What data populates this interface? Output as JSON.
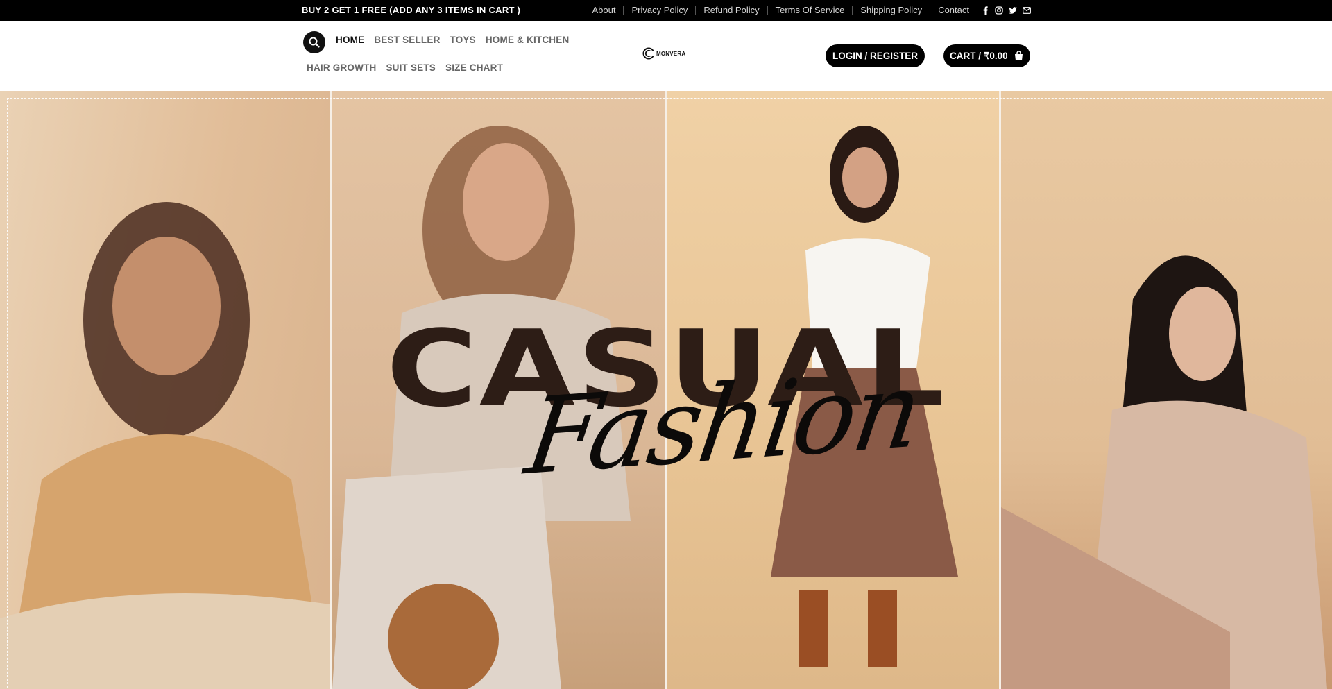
{
  "topbar": {
    "promo": "BUY 2 GET 1 FREE (ADD ANY 3 ITEMS IN CART )",
    "links": [
      "About",
      "Privacy Policy",
      "Refund Policy",
      "Terms Of Service",
      "Shipping Policy",
      "Contact"
    ],
    "social_icons": [
      "facebook-icon",
      "instagram-icon",
      "twitter-icon",
      "email-icon"
    ]
  },
  "header": {
    "nav_row1": [
      "HOME",
      "BEST SELLER",
      "TOYS",
      "HOME & KITCHEN"
    ],
    "nav_row2": [
      "HAIR GROWTH",
      "SUIT SETS",
      "SIZE CHART"
    ],
    "active_nav": "HOME",
    "logo_text": "MONVERA",
    "login_label": "LOGIN / REGISTER",
    "cart_label": "CART / ₹0.00"
  },
  "hero": {
    "title": "CASUAL",
    "script": "Fashion"
  },
  "colors": {
    "topbar_bg": "#000000",
    "button_bg": "#000000",
    "title": "#2d1d16"
  }
}
